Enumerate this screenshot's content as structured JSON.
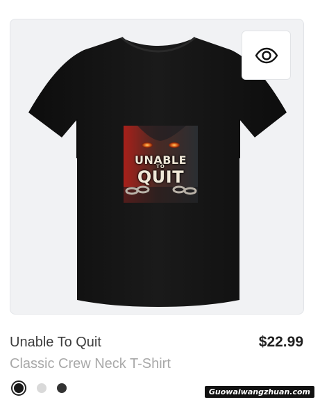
{
  "product": {
    "name": "Unable To Quit",
    "price": "$22.99",
    "type": "Classic Crew Neck T-Shirt",
    "graphic_text": {
      "line1": "UNABLE",
      "line2": "TO",
      "line3": "QUIT"
    }
  },
  "quick_view": {
    "icon": "eye-icon"
  },
  "swatches": [
    {
      "name": "black",
      "color": "#1a1a1a",
      "selected": true
    },
    {
      "name": "light-gray",
      "color": "#d9d9d9",
      "selected": false
    },
    {
      "name": "dark-gray",
      "color": "#333333",
      "selected": false
    }
  ],
  "watermark": {
    "text": "Guowaiwangzhuan.com"
  },
  "colors": {
    "shirt": "#141414",
    "card_background": "#f1f2f4",
    "price": "#1f1f1f",
    "subtitle": "#a8a8a8"
  }
}
